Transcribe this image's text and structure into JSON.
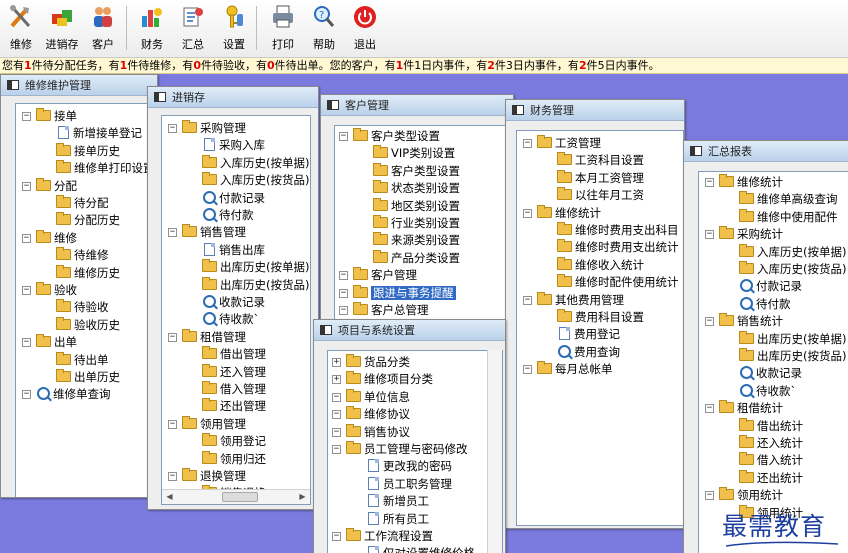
{
  "toolbar": {
    "buttons": [
      {
        "label": "维修",
        "icon": "tools-icon"
      },
      {
        "label": "进销存",
        "icon": "inventory-icon"
      },
      {
        "label": "客户",
        "icon": "customers-icon"
      },
      {
        "label": "财务",
        "icon": "finance-chart-icon"
      },
      {
        "label": "汇总",
        "icon": "summary-icon"
      },
      {
        "label": "设置",
        "icon": "settings-key-icon"
      },
      {
        "label": "打印",
        "icon": "printer-icon"
      },
      {
        "label": "帮助",
        "icon": "help-search-icon"
      },
      {
        "label": "退出",
        "icon": "power-icon"
      }
    ]
  },
  "notice": {
    "parts": [
      "您有",
      "1",
      "件待分配任务，有",
      "1",
      "件待维修，有",
      "0",
      "件待验收，有",
      "0",
      "件待出单。您的客户，有",
      "1",
      "件1日内事件，有",
      "2",
      "件3日内事件，有",
      "2",
      "件5日内事件。"
    ]
  },
  "windows": {
    "repair": {
      "title": "维修维护管理",
      "nodes": [
        {
          "t": "接单",
          "k": "folder",
          "lv": 0
        },
        {
          "t": "新增接单登记",
          "k": "doc",
          "lv": 1
        },
        {
          "t": "接单历史",
          "k": "folder",
          "lv": 1
        },
        {
          "t": "维修单打印设置",
          "k": "folder",
          "lv": 1
        },
        {
          "t": "分配",
          "k": "folder",
          "lv": 0
        },
        {
          "t": "待分配",
          "k": "folder",
          "lv": 1
        },
        {
          "t": "分配历史",
          "k": "folder",
          "lv": 1
        },
        {
          "t": "维修",
          "k": "folder",
          "lv": 0
        },
        {
          "t": "待维修",
          "k": "folder",
          "lv": 1
        },
        {
          "t": "维修历史",
          "k": "folder",
          "lv": 1
        },
        {
          "t": "验收",
          "k": "folder",
          "lv": 0
        },
        {
          "t": "待验收",
          "k": "folder",
          "lv": 1
        },
        {
          "t": "验收历史",
          "k": "folder",
          "lv": 1
        },
        {
          "t": "出单",
          "k": "folder",
          "lv": 0
        },
        {
          "t": "待出单",
          "k": "folder",
          "lv": 1
        },
        {
          "t": "出单历史",
          "k": "folder",
          "lv": 1
        },
        {
          "t": "维修单查询",
          "k": "search",
          "lv": 0
        }
      ]
    },
    "inventory": {
      "title": "进销存",
      "nodes": [
        {
          "t": "采购管理",
          "k": "folder",
          "lv": 0
        },
        {
          "t": "采购入库",
          "k": "doc",
          "lv": 1
        },
        {
          "t": "入库历史(按单据)",
          "k": "folder",
          "lv": 1
        },
        {
          "t": "入库历史(按货品)",
          "k": "folder",
          "lv": 1
        },
        {
          "t": "付款记录",
          "k": "search",
          "lv": 1
        },
        {
          "t": "待付款",
          "k": "search",
          "lv": 1
        },
        {
          "t": "销售管理",
          "k": "folder",
          "lv": 0
        },
        {
          "t": "销售出库",
          "k": "doc",
          "lv": 1
        },
        {
          "t": "出库历史(按单据)",
          "k": "folder",
          "lv": 1
        },
        {
          "t": "出库历史(按货品)",
          "k": "folder",
          "lv": 1
        },
        {
          "t": "收款记录",
          "k": "search",
          "lv": 1
        },
        {
          "t": "待收款`",
          "k": "search",
          "lv": 1
        },
        {
          "t": "租借管理",
          "k": "folder",
          "lv": 0
        },
        {
          "t": "借出管理",
          "k": "folder",
          "lv": 1
        },
        {
          "t": "还入管理",
          "k": "folder",
          "lv": 1
        },
        {
          "t": "借入管理",
          "k": "folder",
          "lv": 1
        },
        {
          "t": "还出管理",
          "k": "folder",
          "lv": 1
        },
        {
          "t": "领用管理",
          "k": "folder",
          "lv": 0
        },
        {
          "t": "领用登记",
          "k": "folder",
          "lv": 1
        },
        {
          "t": "领用归还",
          "k": "folder",
          "lv": 1
        },
        {
          "t": "退换管理",
          "k": "folder",
          "lv": 0
        },
        {
          "t": "销售退换",
          "k": "folder",
          "lv": 1
        }
      ]
    },
    "customer": {
      "title": "客户管理",
      "nodes": [
        {
          "t": "客户类型设置",
          "k": "folder",
          "lv": 0
        },
        {
          "t": "VIP类别设置",
          "k": "folder",
          "lv": 1
        },
        {
          "t": "客户类型设置",
          "k": "folder",
          "lv": 1
        },
        {
          "t": "状态类别设置",
          "k": "folder",
          "lv": 1
        },
        {
          "t": "地区类别设置",
          "k": "folder",
          "lv": 1
        },
        {
          "t": "行业类别设置",
          "k": "folder",
          "lv": 1
        },
        {
          "t": "来源类别设置",
          "k": "folder",
          "lv": 1
        },
        {
          "t": "产品分类设置",
          "k": "folder",
          "lv": 1
        },
        {
          "t": "客户管理",
          "k": "folder",
          "lv": 0
        },
        {
          "t": "跟进与事务提醒",
          "k": "folder",
          "lv": 0,
          "selected": true
        },
        {
          "t": "客户总管理",
          "k": "folder",
          "lv": 0
        }
      ]
    },
    "finance": {
      "title": "财务管理",
      "nodes": [
        {
          "t": "工资管理",
          "k": "folder",
          "lv": 0
        },
        {
          "t": "工资科目设置",
          "k": "folder",
          "lv": 1
        },
        {
          "t": "本月工资管理",
          "k": "folder",
          "lv": 1
        },
        {
          "t": "以往年月工资",
          "k": "folder",
          "lv": 1
        },
        {
          "t": "维修统计",
          "k": "folder",
          "lv": 0
        },
        {
          "t": "维修时费用支出科目",
          "k": "folder",
          "lv": 1
        },
        {
          "t": "维修时费用支出统计",
          "k": "folder",
          "lv": 1
        },
        {
          "t": "维修收入统计",
          "k": "folder",
          "lv": 1
        },
        {
          "t": "维修时配件使用统计",
          "k": "folder",
          "lv": 1
        },
        {
          "t": "其他费用管理",
          "k": "folder",
          "lv": 0
        },
        {
          "t": "费用科目设置",
          "k": "folder",
          "lv": 1
        },
        {
          "t": "费用登记",
          "k": "doc",
          "lv": 1
        },
        {
          "t": "费用查询",
          "k": "search",
          "lv": 1
        },
        {
          "t": "每月总帐单",
          "k": "folder",
          "lv": 0
        }
      ]
    },
    "summary": {
      "title": "汇总报表",
      "nodes": [
        {
          "t": "维修统计",
          "k": "folder",
          "lv": 0
        },
        {
          "t": "维修单高级查询",
          "k": "folder",
          "lv": 1
        },
        {
          "t": "维修中使用配件",
          "k": "folder",
          "lv": 1
        },
        {
          "t": "采购统计",
          "k": "folder",
          "lv": 0
        },
        {
          "t": "入库历史(按单据)",
          "k": "folder",
          "lv": 1
        },
        {
          "t": "入库历史(按货品)",
          "k": "folder",
          "lv": 1
        },
        {
          "t": "付款记录",
          "k": "search",
          "lv": 1
        },
        {
          "t": "待付款",
          "k": "search",
          "lv": 1
        },
        {
          "t": "销售统计",
          "k": "folder",
          "lv": 0
        },
        {
          "t": "出库历史(按单据)",
          "k": "folder",
          "lv": 1
        },
        {
          "t": "出库历史(按货品)",
          "k": "folder",
          "lv": 1
        },
        {
          "t": "收款记录",
          "k": "search",
          "lv": 1
        },
        {
          "t": "待收款`",
          "k": "search",
          "lv": 1
        },
        {
          "t": "租借统计",
          "k": "folder",
          "lv": 0
        },
        {
          "t": "借出统计",
          "k": "folder",
          "lv": 1
        },
        {
          "t": "还入统计",
          "k": "folder",
          "lv": 1
        },
        {
          "t": "借入统计",
          "k": "folder",
          "lv": 1
        },
        {
          "t": "还出统计",
          "k": "folder",
          "lv": 1
        },
        {
          "t": "领用统计",
          "k": "folder",
          "lv": 0
        },
        {
          "t": "领用统计",
          "k": "folder",
          "lv": 1
        }
      ]
    },
    "project": {
      "title": "项目与系统设置",
      "nodes": [
        {
          "t": "货品分类",
          "k": "folder",
          "lv": 0,
          "collapsed": true
        },
        {
          "t": "维修项目分类",
          "k": "folder",
          "lv": 0,
          "collapsed": true
        },
        {
          "t": "单位信息",
          "k": "folder",
          "lv": 0
        },
        {
          "t": "维修协议",
          "k": "folder",
          "lv": 0
        },
        {
          "t": "销售协议",
          "k": "folder",
          "lv": 0
        },
        {
          "t": "员工管理与密码修改",
          "k": "folder",
          "lv": 0
        },
        {
          "t": "更改我的密码",
          "k": "doc",
          "lv": 1
        },
        {
          "t": "员工职务管理",
          "k": "doc",
          "lv": 1
        },
        {
          "t": "新增员工",
          "k": "doc",
          "lv": 1
        },
        {
          "t": "所有员工",
          "k": "doc",
          "lv": 1
        },
        {
          "t": "工作流程设置",
          "k": "folder",
          "lv": 0
        },
        {
          "t": "仅对设置维修价格",
          "k": "doc",
          "lv": 1
        }
      ]
    }
  },
  "watermark": "最需教育",
  "colors": {
    "desktop": "#7b7bdf",
    "accent_red": "#e00000",
    "selection": "#316ac5",
    "watermark": "#1f3f9f"
  }
}
